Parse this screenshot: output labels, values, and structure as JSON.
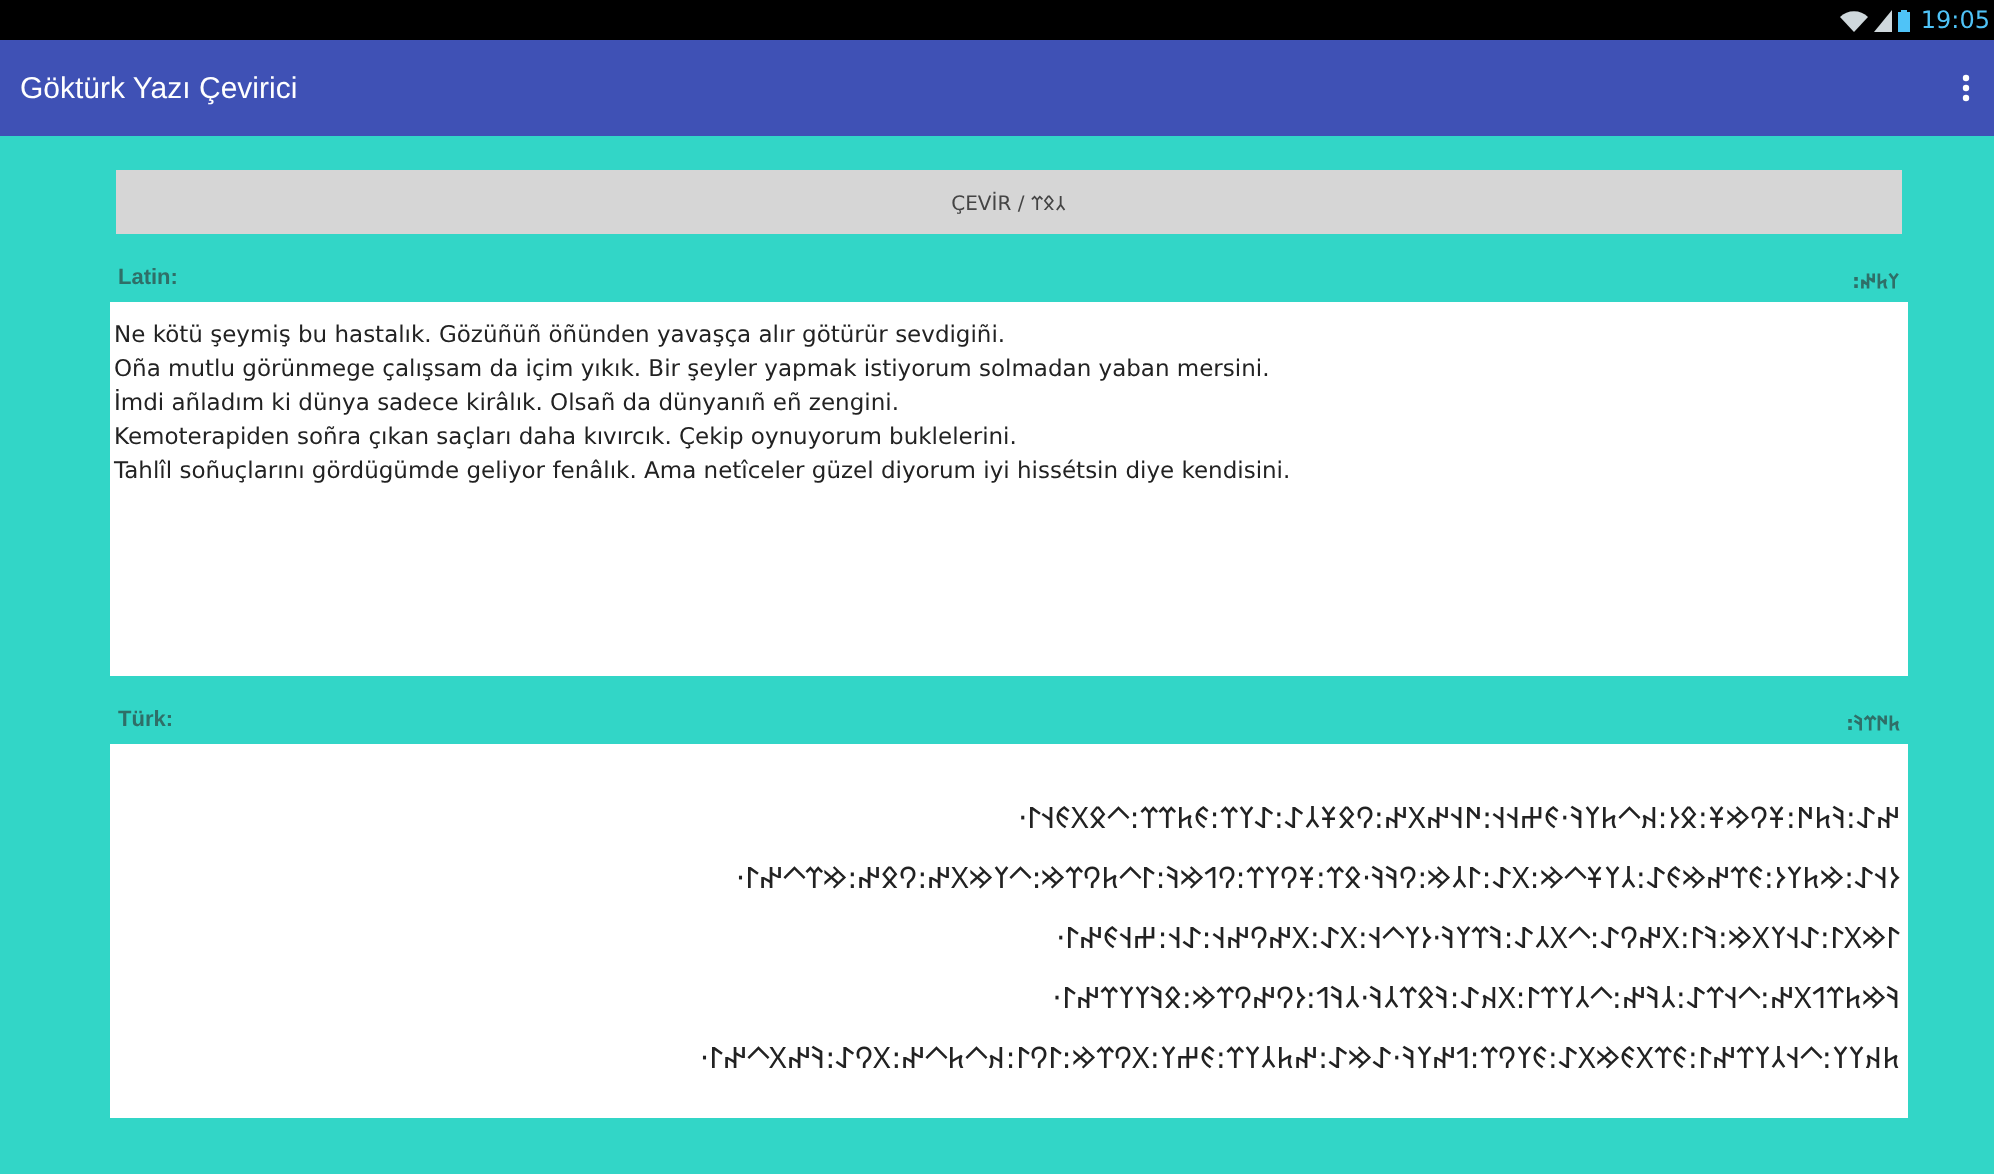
{
  "status_bar": {
    "time": "19:05"
  },
  "app_bar": {
    "title": "Göktürk Yazı Çevirici"
  },
  "convert_button": {
    "label": "ÇEVİR / 𐰲𐰋𐰼"
  },
  "sections": [
    {
      "label": "Latin:",
      "label_runic": "𐰠𐱅𐰤:",
      "kind": "latin",
      "lines": [
        "Ne kötü şeymiş bu hastalık. Gözüñüñ öñünden yavaşça alır götürür sevdigiñi.",
        "Oña mutlu görünmege çalışsam da içim yıkık. Bir şeyler yapmak istiyorum solmadan yaban mersini.",
        "İmdi añladım ki dünya sadece kirâlık. Olsañ da dünyanıñ eñ zengini.",
        "Kemoterapiden soñra çıkan saçları daha kıvırcık. Çekip oynuyorum buklelerini.",
        "Tahlîl soñuçlarını gördügümde geliyor fenâlık. Ama netîceler güzel diyorum iyi hissétsin diye kendisini."
      ]
    },
    {
      "label": "Türk:",
      "label_runic": "𐱅𐰇𐰼𐰚:",
      "kind": "runic",
      "lines": [
        "𐰤𐰀:𐰚𐱅𐰇:𐱁𐰘𐰢𐱁:𐰋𐰆:𐰴𐱀𐱅𐰠𐰚·𐰏𐰔𐰭𐰭:𐰇𐰭𐰤𐰓𐰤:𐰘𐰋𐱁𐰲𐰀:𐰀𐰠𐰼:𐰏𐱅𐰼𐰼:𐱀𐰋𐰓𐰏𐰭𐰃·",
        "𐰆𐰭𐰀:𐰢𐱅𐰠𐰆:𐰏𐰼𐰤𐰢𐰏𐰀:𐰲𐰠𐱁𐱀𐰢:𐰓𐰀:𐰃𐰲𐰢:𐰘𐰚𐰚·𐰋𐰼:𐱁𐰘𐰠𐰼:𐰘𐰯𐰢𐰚:𐰃𐱀𐱅𐰘𐰼𐰢:𐱀𐰠𐰢𐰓𐰤:𐰘𐰋𐰤:𐰢𐰼𐱀𐰤𐰃·",
        "𐰃𐰢𐰓𐰃:𐰀𐰭𐰠𐰓𐰢:𐰚𐰃:𐰓𐰤𐰘𐰀:𐱀𐰓𐰲𐰀:𐰚𐰼𐰠𐰚·𐰆𐰠𐱀𐰭:𐰓𐰀:𐰓𐰤𐰘𐰤𐰭:𐰀𐰭:𐰔𐰭𐰏𐰤𐰃·",
        "𐰚𐰢𐱅𐰼𐰯𐰓𐰤:𐱀𐰭𐰼𐰀:𐰲𐰚𐰤:𐱀𐰲𐰠𐰼𐰃:𐰓𐰴𐰀:𐰚𐰋𐰼𐰲𐰚·𐰲𐰚𐰯:𐰆𐰘𐰤𐰘𐰼𐰢:𐰋𐰚𐰠𐰠𐰼𐰤𐰃·",
        "𐱅𐰴𐰠𐰠:𐱀𐰭𐰲𐰠𐰼𐰤𐰃:𐰏𐰼𐰓𐰏𐰢𐰓𐰀:𐰏𐰠𐰘𐰼:𐰯𐰤𐰠𐰚·𐰀𐰢𐰀:𐰤𐱅𐰲𐰠𐰼:𐰏𐰔𐰠:𐰓𐰘𐰼𐰢:𐰃𐰘𐰃:𐰴𐱀𐱅𐱀𐰤:𐰓𐰘𐰀:𐰚𐰤𐰓𐱀𐰤𐰃·"
      ]
    }
  ]
}
